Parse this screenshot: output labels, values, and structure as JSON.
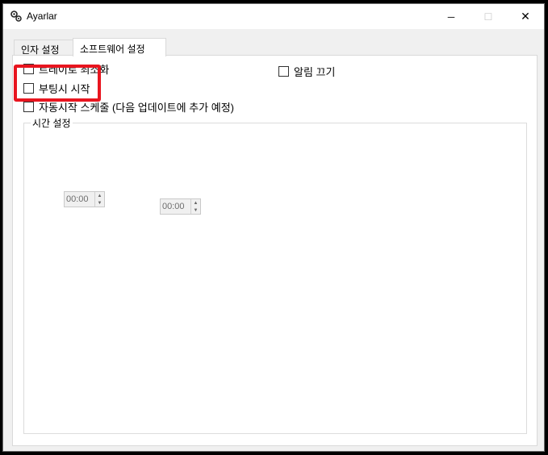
{
  "window": {
    "title": "Ayarlar",
    "icon": "gears-icon",
    "controls": {
      "minimize": "─",
      "maximize": "☐",
      "close": "✕"
    }
  },
  "tabs": [
    {
      "label": "인자 설정",
      "active": false
    },
    {
      "label": "소프트웨어 설정",
      "active": true
    }
  ],
  "options": {
    "tray_label": "트레이로 최소화",
    "alarm_off_label": "알림 끄기",
    "boot_start_label": "부팅시 시작",
    "auto_schedule_label": "자동시작 스케줄 (다음 업데이트에 추가 예정)"
  },
  "time_group": {
    "legend": "시간 설정",
    "start_time": "00:00",
    "end_time": "00:00"
  },
  "colors": {
    "highlight": "#e8151f",
    "panel": "#ffffff",
    "window_bg": "#f0f0f0"
  }
}
